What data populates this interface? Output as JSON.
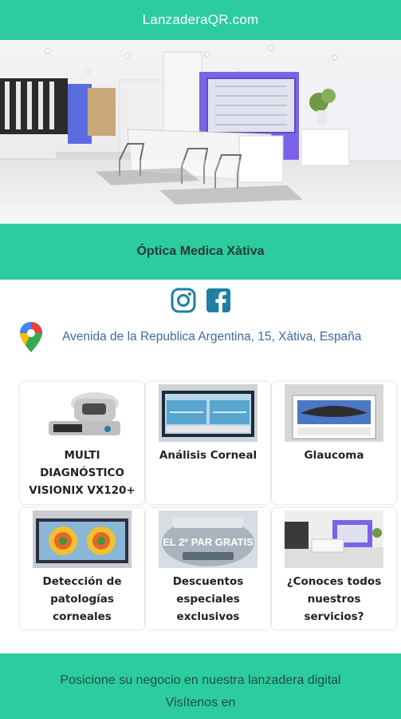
{
  "header": {
    "site": "LanzaderaQR.com"
  },
  "business": {
    "name": "Óptica Medica Xàtiva"
  },
  "social": {
    "icons": [
      "instagram-icon",
      "facebook-icon"
    ]
  },
  "location": {
    "address": "Avenida de la Republica Argentina, 15, Xàtiva, España",
    "icon": "map-pin-icon"
  },
  "cards": [
    {
      "title": "MULTI DIAGNÓSTICO VISIONIX VX120+"
    },
    {
      "title": "Análisis Corneal"
    },
    {
      "title": "Glaucoma"
    },
    {
      "title": "Detección de patologías corneales"
    },
    {
      "title": "Descuentos especiales exclusivos"
    },
    {
      "title": "¿Conoces todos nuestros servicios?"
    }
  ],
  "promo": {
    "text": "EL 2º PAR GRATIS"
  },
  "footer": {
    "line1": "Posicione su negocio en nuestra lanzadera digital",
    "line2": "Visítenos en"
  },
  "colors": {
    "accent": "#2ccca0",
    "link": "#3c6aa6"
  }
}
